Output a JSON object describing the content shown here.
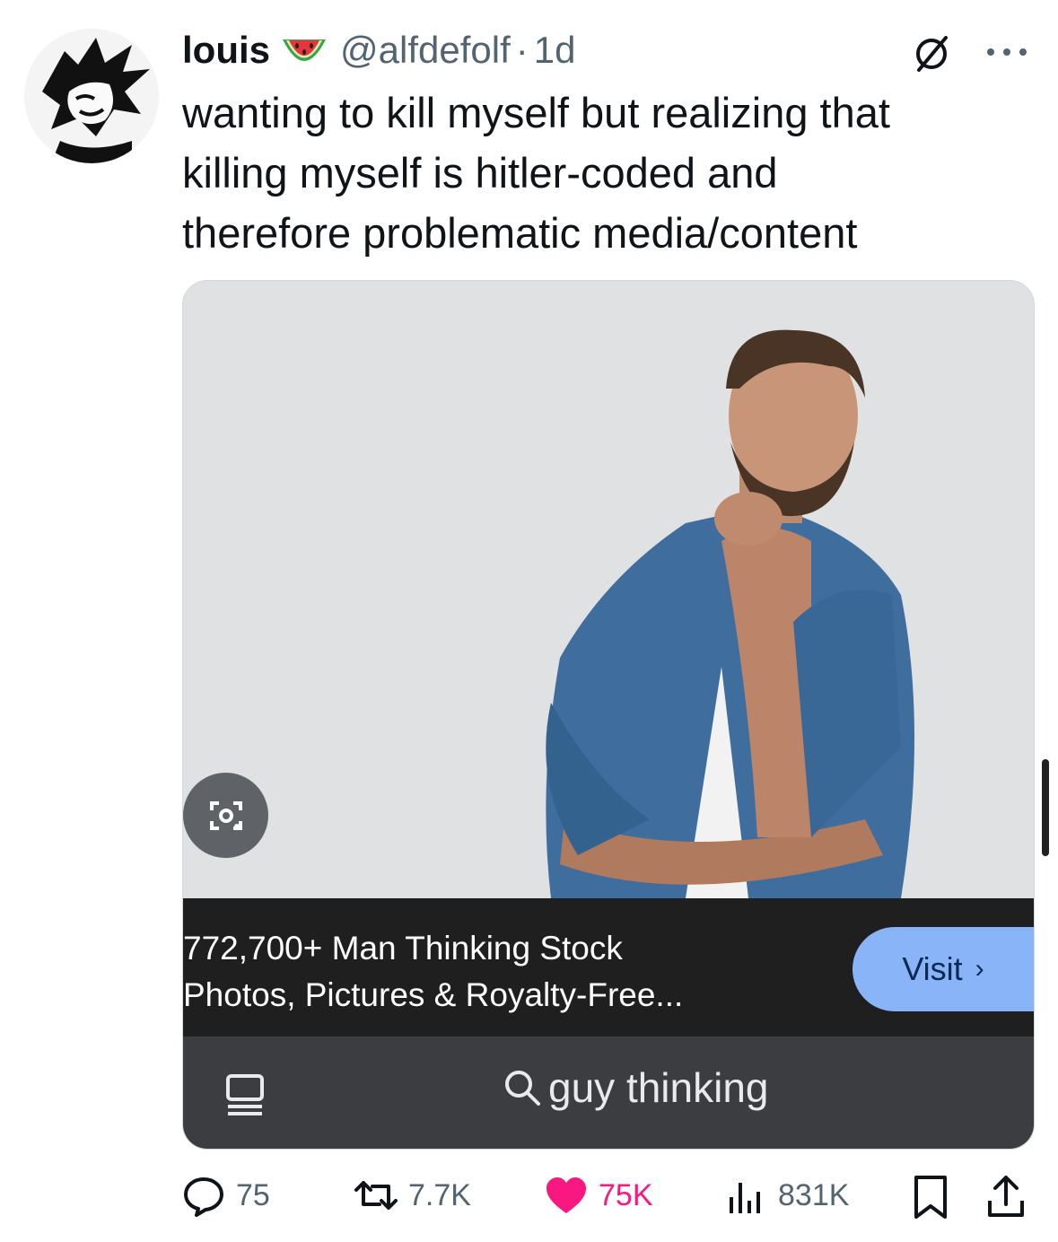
{
  "tweet": {
    "display_name": "louis",
    "name_emoji": "watermelon-icon",
    "handle": "@alfdefolf",
    "separator": "·",
    "age": "1d",
    "text": "wanting to kill myself but realizing that\nkilling myself is hitler-coded and\ntherefore problematic media/content"
  },
  "media": {
    "result_title": "772,700+ Man Thinking Stock\nPhotos, Pictures & Royalty-Free...",
    "visit_label": "Visit",
    "visit_chevron": "›",
    "search_query": "guy thinking"
  },
  "actions": {
    "replies": "75",
    "reposts": "7.7K",
    "likes": "75K",
    "views": "831K"
  },
  "colors": {
    "accent_like": "#f91880",
    "muted": "#536471",
    "visit_button": "#8ab4f8",
    "lens_bar": "#3c3d40"
  }
}
